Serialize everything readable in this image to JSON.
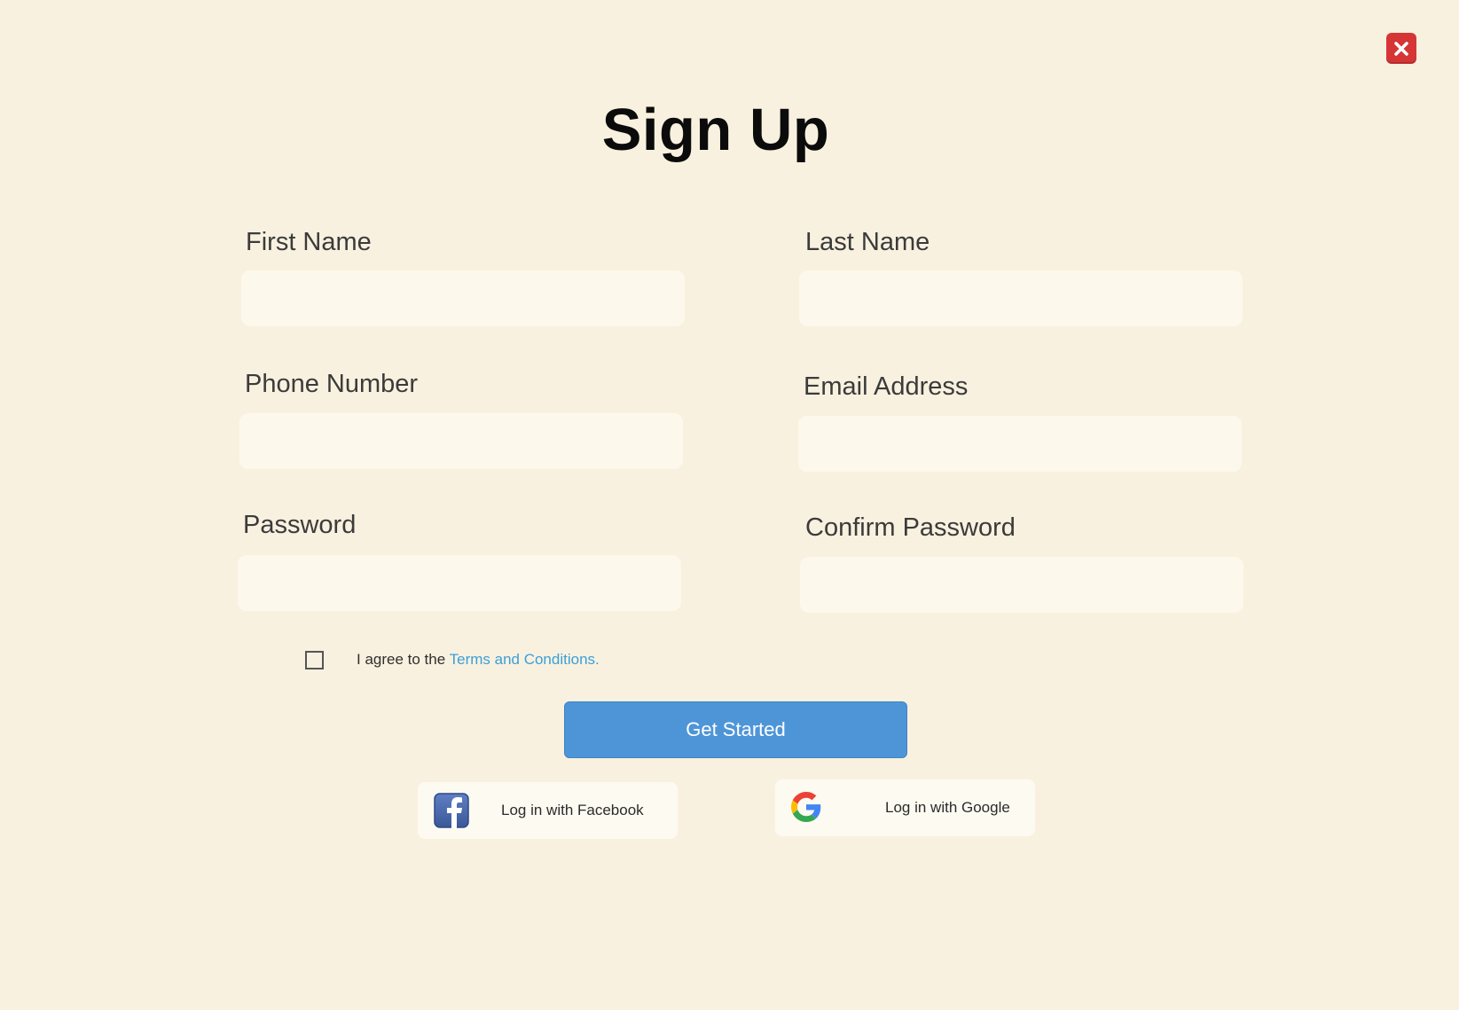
{
  "page": {
    "title": "Sign Up"
  },
  "form": {
    "first_name": {
      "label": "First Name",
      "value": "",
      "placeholder": ""
    },
    "last_name": {
      "label": "Last Name",
      "value": "",
      "placeholder": ""
    },
    "phone": {
      "label": "Phone Number",
      "value": "",
      "placeholder": ""
    },
    "email": {
      "label": "Email Address",
      "value": "",
      "placeholder": ""
    },
    "password": {
      "label": "Password",
      "value": "",
      "placeholder": ""
    },
    "confirm_password": {
      "label": "Confirm Password",
      "value": "",
      "placeholder": ""
    }
  },
  "agreement": {
    "checked": false,
    "prefix": "I agree to the ",
    "link_text": "Terms and Conditions."
  },
  "actions": {
    "submit_label": "Get Started",
    "facebook_label": "Log in with Facebook",
    "google_label": "Log in with Google"
  },
  "icons": {
    "close": "close-icon",
    "facebook": "facebook-icon",
    "google": "google-icon"
  },
  "colors": {
    "background": "#f9f1df",
    "input_background": "#fcf8ec",
    "primary_button": "#4e95d8",
    "link": "#3aa0d8",
    "close_button": "#d63535",
    "facebook_blue": "#3b5998"
  }
}
